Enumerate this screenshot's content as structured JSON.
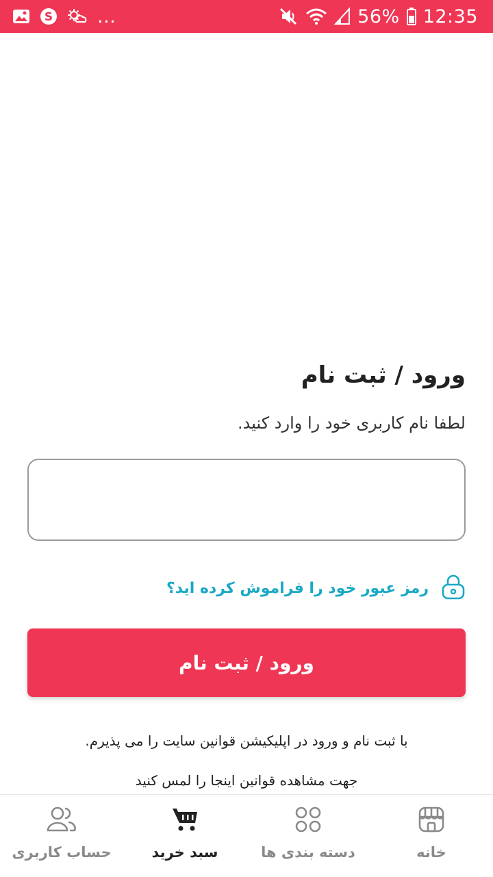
{
  "status_bar": {
    "battery_percent": "56%",
    "time": "12:35",
    "dots": "...",
    "icons": [
      "gallery-icon",
      "skype-icon",
      "weather-icon",
      "mute-icon",
      "wifi-icon",
      "signal-icon",
      "battery-icon"
    ]
  },
  "login": {
    "title": "ورود / ثبت نام",
    "subtitle": "لطفا نام کاربری خود را وارد کنید.",
    "username_value": "",
    "username_placeholder": "",
    "forgot_password": "رمز عبور خود را فراموش کرده اید؟",
    "submit_label": "ورود / ثبت نام",
    "terms_line1": "با ثبت نام و ورود در اپلیکیشن قوانین سایت را می پذیرم.",
    "terms_line2": "جهت مشاهده قوانین اینجا را لمس کنید"
  },
  "bottom_nav": {
    "items": [
      {
        "label": "حساب کاربری",
        "icon": "users-icon",
        "active": false
      },
      {
        "label": "سبد خرید",
        "icon": "cart-icon",
        "active": true
      },
      {
        "label": "دسته بندی ها",
        "icon": "categories-icon",
        "active": false
      },
      {
        "label": "خانه",
        "icon": "store-icon",
        "active": false
      }
    ]
  },
  "colors": {
    "accent": "#ef3655",
    "link": "#19a9c5",
    "nav_inactive": "#8a8a8a",
    "nav_active": "#222222"
  }
}
